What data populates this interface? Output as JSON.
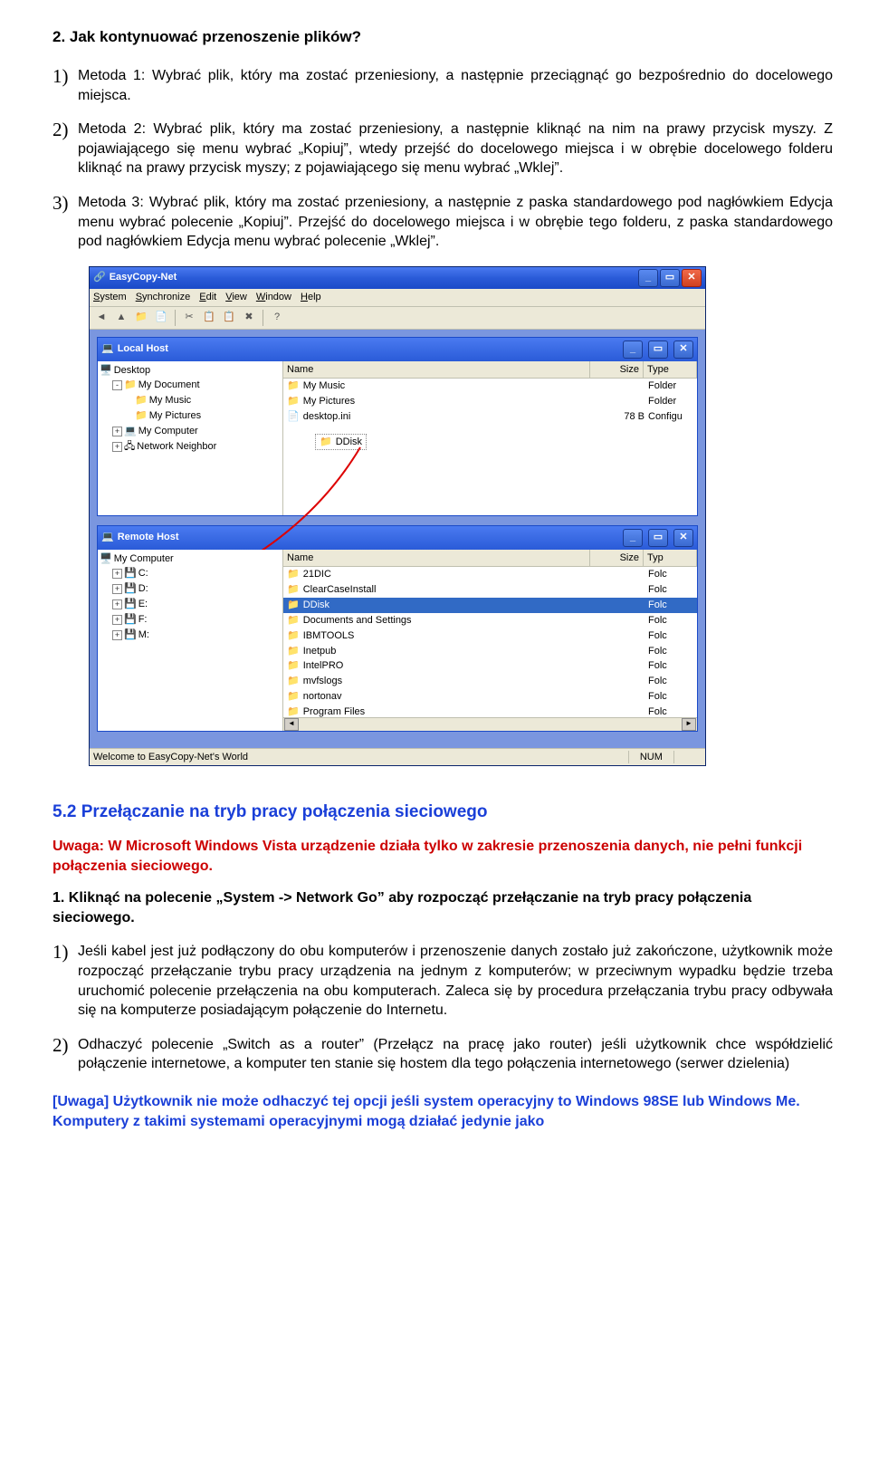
{
  "doc": {
    "heading": "2. Jak kontynuować przenoszenie plików?",
    "methods": [
      {
        "num": "1)",
        "text": "Metoda 1: Wybrać plik, który ma zostać przeniesiony, a następnie przeciągnąć go bezpośrednio do docelowego miejsca."
      },
      {
        "num": "2)",
        "text": "Metoda 2: Wybrać plik, który ma zostać przeniesiony, a następnie kliknąć na nim na prawy przycisk myszy. Z pojawiającego się menu wybrać „Kopiuj”, wtedy przejść do docelowego miejsca i w obrębie docelowego folderu kliknąć na prawy przycisk myszy; z pojawiającego się menu wybrać „Wklej”."
      },
      {
        "num": "3)",
        "text": "Metoda 3: Wybrać plik, który ma zostać przeniesiony, a następnie z paska standardowego pod nagłówkiem Edycja menu wybrać polecenie „Kopiuj”. Przejść do docelowego miejsca i w obrębie tego folderu, z paska standardowego pod nagłówkiem Edycja menu wybrać polecenie „Wklej”."
      }
    ],
    "section52": "5.2 Przełączanie na tryb pracy połączenia sieciowego",
    "warning": "Uwaga: W Microsoft Windows Vista urządzenie działa tylko w zakresie przenoszenia danych, nie pełni funkcji połączenia sieciowego.",
    "step1": "1. Kliknąć na polecenie „System -> Network Go” aby rozpocząć przełączanie na tryb pracy połączenia sieciowego.",
    "list2": [
      {
        "num": "1)",
        "text": "Jeśli kabel jest już podłączony do obu komputerów i przenoszenie danych zostało już zakończone, użytkownik może rozpocząć przełączanie trybu pracy urządzenia na jednym z komputerów; w przeciwnym wypadku będzie trzeba uruchomić polecenie przełączenia na obu komputerach. Zaleca się by procedura przełączania trybu pracy odbywała się na komputerze posiadającym połączenie do Internetu."
      },
      {
        "num": "2)",
        "text": "Odhaczyć polecenie „Switch as a router” (Przełącz na pracę jako router) jeśli użytkownik chce współdzielić połączenie internetowe, a komputer ten stanie się hostem dla tego połączenia internetowego (serwer dzielenia)"
      }
    ],
    "note": "[Uwaga] Użytkownik nie może odhaczyć tej opcji jeśli system operacyjny to Windows 98SE lub Windows Me. Komputery z takimi systemami operacyjnymi mogą działać jedynie jako"
  },
  "app": {
    "title": "EasyCopy-Net",
    "menus": [
      "System",
      "Synchronize",
      "Edit",
      "View",
      "Window",
      "Help"
    ],
    "local": {
      "title": "Local Host",
      "root": "Desktop",
      "tree": [
        {
          "exp": "-",
          "indent": 1,
          "icon": "📁",
          "label": "My Document"
        },
        {
          "exp": " ",
          "indent": 2,
          "icon": "📁",
          "label": "My Music"
        },
        {
          "exp": " ",
          "indent": 2,
          "icon": "📁",
          "label": "My Pictures"
        },
        {
          "exp": "+",
          "indent": 1,
          "icon": "💻",
          "label": "My Computer"
        },
        {
          "exp": "+",
          "indent": 1,
          "icon": "🖧",
          "label": "Network Neighbor"
        }
      ],
      "cols": [
        "Name",
        "Size",
        "Type"
      ],
      "rows": [
        {
          "icon": "📁",
          "name": "My Music",
          "size": "",
          "type": "Folder"
        },
        {
          "icon": "📁",
          "name": "My Pictures",
          "size": "",
          "type": "Folder"
        },
        {
          "icon": "📄",
          "name": "desktop.ini",
          "size": "78 B",
          "type": "Configu"
        }
      ],
      "dragLabel": "DDisk"
    },
    "remote": {
      "title": "Remote Host",
      "root": "My Computer",
      "tree": [
        {
          "exp": "+",
          "indent": 1,
          "icon": "💾",
          "label": "C:"
        },
        {
          "exp": "+",
          "indent": 1,
          "icon": "💾",
          "label": "D:"
        },
        {
          "exp": "+",
          "indent": 1,
          "icon": "💾",
          "label": "E:"
        },
        {
          "exp": "+",
          "indent": 1,
          "icon": "💾",
          "label": "F:"
        },
        {
          "exp": "+",
          "indent": 1,
          "icon": "💾",
          "label": "M:"
        }
      ],
      "cols": [
        "Name",
        "Size",
        "Typ"
      ],
      "rows": [
        {
          "icon": "📁",
          "name": "21DIC",
          "size": "",
          "type": "Folc"
        },
        {
          "icon": "📁",
          "name": "ClearCaseInstall",
          "size": "",
          "type": "Folc"
        },
        {
          "icon": "📁",
          "name": "DDisk",
          "size": "",
          "type": "Folc",
          "sel": true
        },
        {
          "icon": "📁",
          "name": "Documents and Settings",
          "size": "",
          "type": "Folc"
        },
        {
          "icon": "📁",
          "name": "IBMTOOLS",
          "size": "",
          "type": "Folc"
        },
        {
          "icon": "📁",
          "name": "Inetpub",
          "size": "",
          "type": "Folc"
        },
        {
          "icon": "📁",
          "name": "IntelPRO",
          "size": "",
          "type": "Folc"
        },
        {
          "icon": "📁",
          "name": "mvfslogs",
          "size": "",
          "type": "Folc"
        },
        {
          "icon": "📁",
          "name": "nortonav",
          "size": "",
          "type": "Folc"
        },
        {
          "icon": "📁",
          "name": "Program Files",
          "size": "",
          "type": "Folc"
        }
      ]
    },
    "status": {
      "text": "Welcome to EasyCopy-Net's World",
      "num": "NUM"
    }
  }
}
